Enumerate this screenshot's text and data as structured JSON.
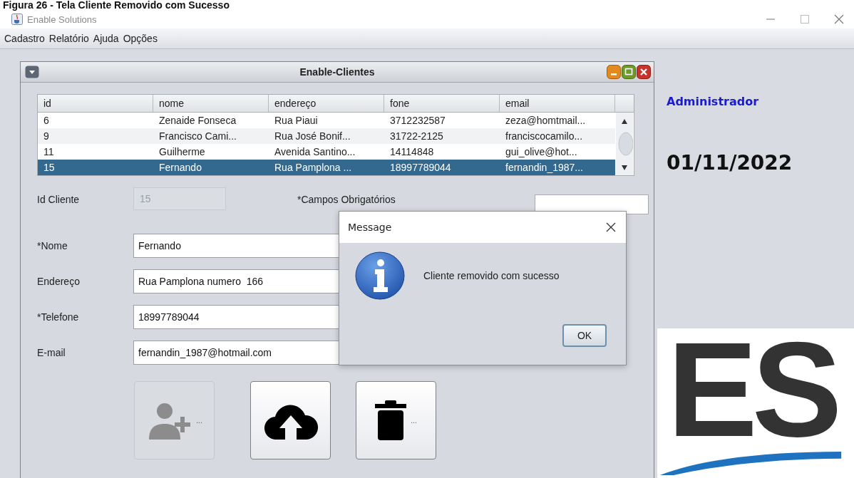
{
  "caption": "Figura 26 - Tela Cliente Removido com Sucesso",
  "window": {
    "title": "Enable Solutions"
  },
  "menu": [
    "Cadastro",
    "Relatório",
    "Ajuda",
    "Opções"
  ],
  "frame": {
    "title": "Enable-Clientes",
    "table": {
      "columns": [
        "id",
        "nome",
        "endereço",
        "fone",
        "email"
      ],
      "rows": [
        {
          "cells": [
            "6",
            "Zenaide Fonseca",
            "Rua Piaui",
            "3712232587",
            "zeza@homtmail..."
          ],
          "selected": false
        },
        {
          "cells": [
            "9",
            "Francisco Cami...",
            "Rua José Bonif...",
            "31722-2125",
            "franciscocamilo..."
          ],
          "selected": false
        },
        {
          "cells": [
            "11",
            "Guilherme",
            "Avenida Santino...",
            "14114848",
            "gui_olive@hot..."
          ],
          "selected": false
        },
        {
          "cells": [
            "15",
            "Fernando",
            "Rua Pamplona ...",
            "18997789044",
            "fernandin_1987..."
          ],
          "selected": true
        }
      ]
    },
    "id_label": "Id Cliente",
    "id_value": "15",
    "required_note": "*Campos Obrigatórios",
    "fields": [
      {
        "label": "*Nome",
        "value": "Fernando"
      },
      {
        "label": "Endereço",
        "value": "Rua Pamplona numero  166"
      },
      {
        "label": "*Telefone",
        "value": "18997789044"
      },
      {
        "label": "E-mail",
        "value": "fernandin_1987@hotmail.com"
      }
    ],
    "buttons": [
      {
        "kind": "add-user",
        "label": "...",
        "disabled": true
      },
      {
        "kind": "upload",
        "disabled": false
      },
      {
        "kind": "delete",
        "label": "...",
        "disabled": false
      }
    ]
  },
  "sidebar": {
    "user": "Administrador",
    "date": "01/11/2022",
    "logo_text": "ES"
  },
  "dialog": {
    "title": "Message",
    "message": "Cliente removido com sucesso",
    "button": "OK"
  }
}
